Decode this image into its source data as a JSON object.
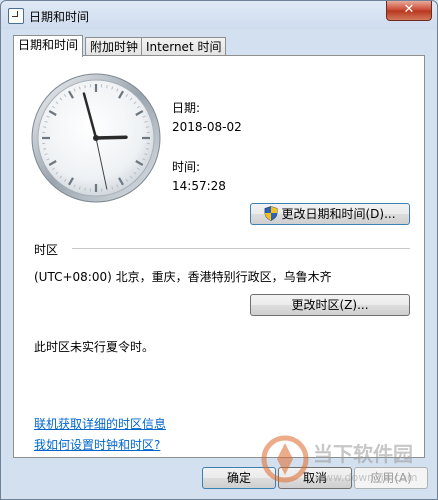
{
  "window": {
    "title": "日期和时间",
    "close_glyph": "✕"
  },
  "tabs": [
    {
      "label": "日期和时间"
    },
    {
      "label": "附加时钟"
    },
    {
      "label": "Internet 时间"
    }
  ],
  "date": {
    "label": "日期:",
    "value": "2018-08-02"
  },
  "time": {
    "label": "时间:",
    "value": "14:57:28"
  },
  "change_datetime_button": "更改日期和时间(D)...",
  "timezone": {
    "section_label": "时区",
    "value": "(UTC+08:00) 北京，重庆，香港特别行政区，乌鲁木齐",
    "change_button": "更改时区(Z)...",
    "dst_note": "此时区未实行夏令时。"
  },
  "links": {
    "timezone_info": "联机获取详细的时区信息",
    "how_to_set": "我如何设置时钟和时区?"
  },
  "footer": {
    "ok": "确定",
    "cancel": "取消",
    "apply": "应用(A)"
  },
  "clock": {
    "hours": 14,
    "minutes": 57,
    "seconds": 28
  },
  "watermark": {
    "brand": "当下软件园",
    "url": "www.downxia.com"
  }
}
